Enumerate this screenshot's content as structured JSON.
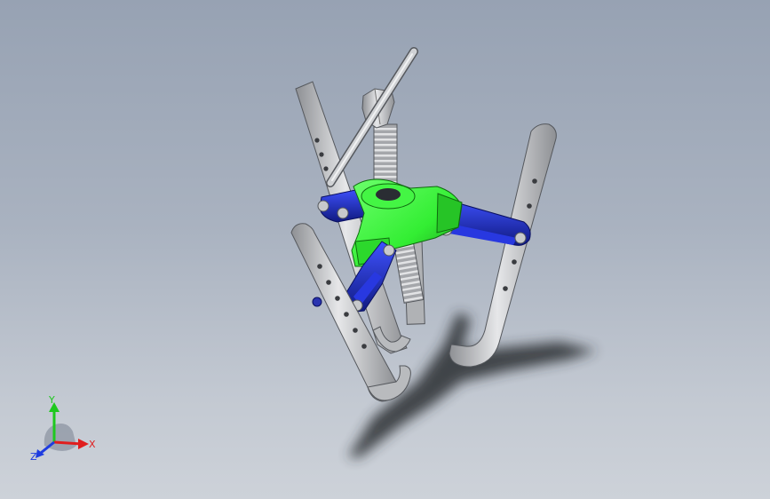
{
  "window": {
    "background_top": "#97a2b3",
    "background_bottom": "#cdd2d9"
  },
  "model": {
    "colors": {
      "steel": "#c7c9cc",
      "steel_shade": "#8e9094",
      "steel_dark": "#55585d",
      "link": "#1f2fd1",
      "link_dark": "#101a80",
      "hub": "#33ee33",
      "hub_dark": "#1a9a1a",
      "shadow": "#2a2d33"
    }
  },
  "triad": {
    "x_label": "X",
    "y_label": "Y",
    "z_label": "Z",
    "x_color": "#e01e1e",
    "y_color": "#1ec81e",
    "z_color": "#1e3ce0"
  }
}
